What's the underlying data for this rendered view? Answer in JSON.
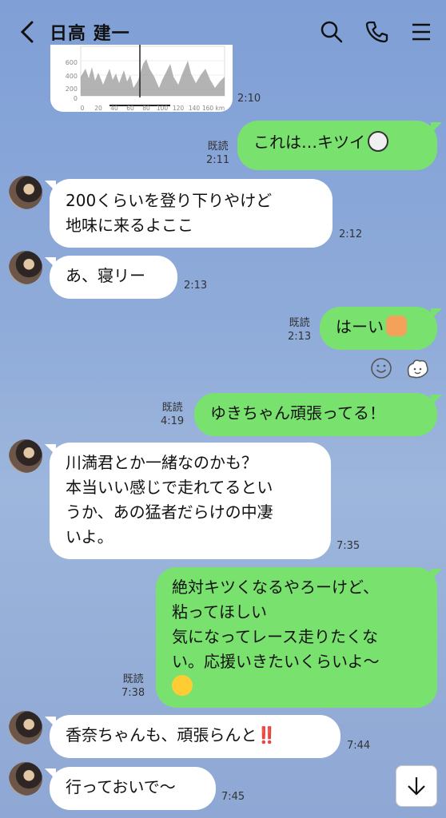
{
  "header": {
    "title": "日高 建一"
  },
  "chart_image": {
    "y_ticks": [
      "600",
      "400",
      "200",
      "0"
    ],
    "x_ticks": [
      "0",
      "20",
      "40",
      "60",
      "80",
      "100",
      "120",
      "140",
      "160 km"
    ],
    "time": "2:10"
  },
  "messages": [
    {
      "id": "m1",
      "side": "mine",
      "text": "これは…キツイ",
      "read": "既読",
      "time": "2:11",
      "emoji": "face-icon"
    },
    {
      "id": "m2",
      "side": "theirs",
      "lines": [
        "200くらいを登り下りやけど",
        "地味に来るよここ"
      ],
      "time": "2:12"
    },
    {
      "id": "m3",
      "side": "theirs",
      "text": "あ、寝リー",
      "time": "2:13"
    },
    {
      "id": "m4",
      "side": "mine",
      "text": "はーい",
      "read": "既読",
      "time": "2:13",
      "emoji": "person-raising-hand-icon"
    },
    {
      "id": "m5",
      "side": "mine",
      "text": "ゆきちゃん頑張ってる！",
      "read": "既読",
      "time": "4:19"
    },
    {
      "id": "m6",
      "side": "theirs",
      "lines": [
        "川満君とか一緒なのかも？",
        "本当いい感じで走れてるとい",
        "うか、あの猛者だらけの中凄",
        "いよ。"
      ],
      "time": "7:35"
    },
    {
      "id": "m7",
      "side": "mine",
      "lines": [
        "絶対キツくなるやろーけど、",
        "粘ってほしい",
        "気になってレース走りたくな",
        "い。応援いきたいくらいよ〜"
      ],
      "read": "既読",
      "time": "7:38",
      "emoji": "laughing-face-icon"
    },
    {
      "id": "m8",
      "side": "theirs",
      "text": "香奈ちゃんも、頑張らんと",
      "suffix": "‼️",
      "time": "7:44"
    },
    {
      "id": "m9",
      "side": "theirs",
      "text": "行っておいで〜",
      "time": "7:45"
    }
  ],
  "icons": {
    "back": "chevron-left-icon",
    "search": "search-icon",
    "call": "phone-icon",
    "menu": "menu-icon",
    "react": "smiley-icon",
    "sticker": "sticker-icon",
    "scroll": "arrow-down-icon"
  },
  "colors": {
    "background": "#8aa6d6",
    "mine_bubble": "#79e26e",
    "theirs_bubble": "#ffffff"
  }
}
